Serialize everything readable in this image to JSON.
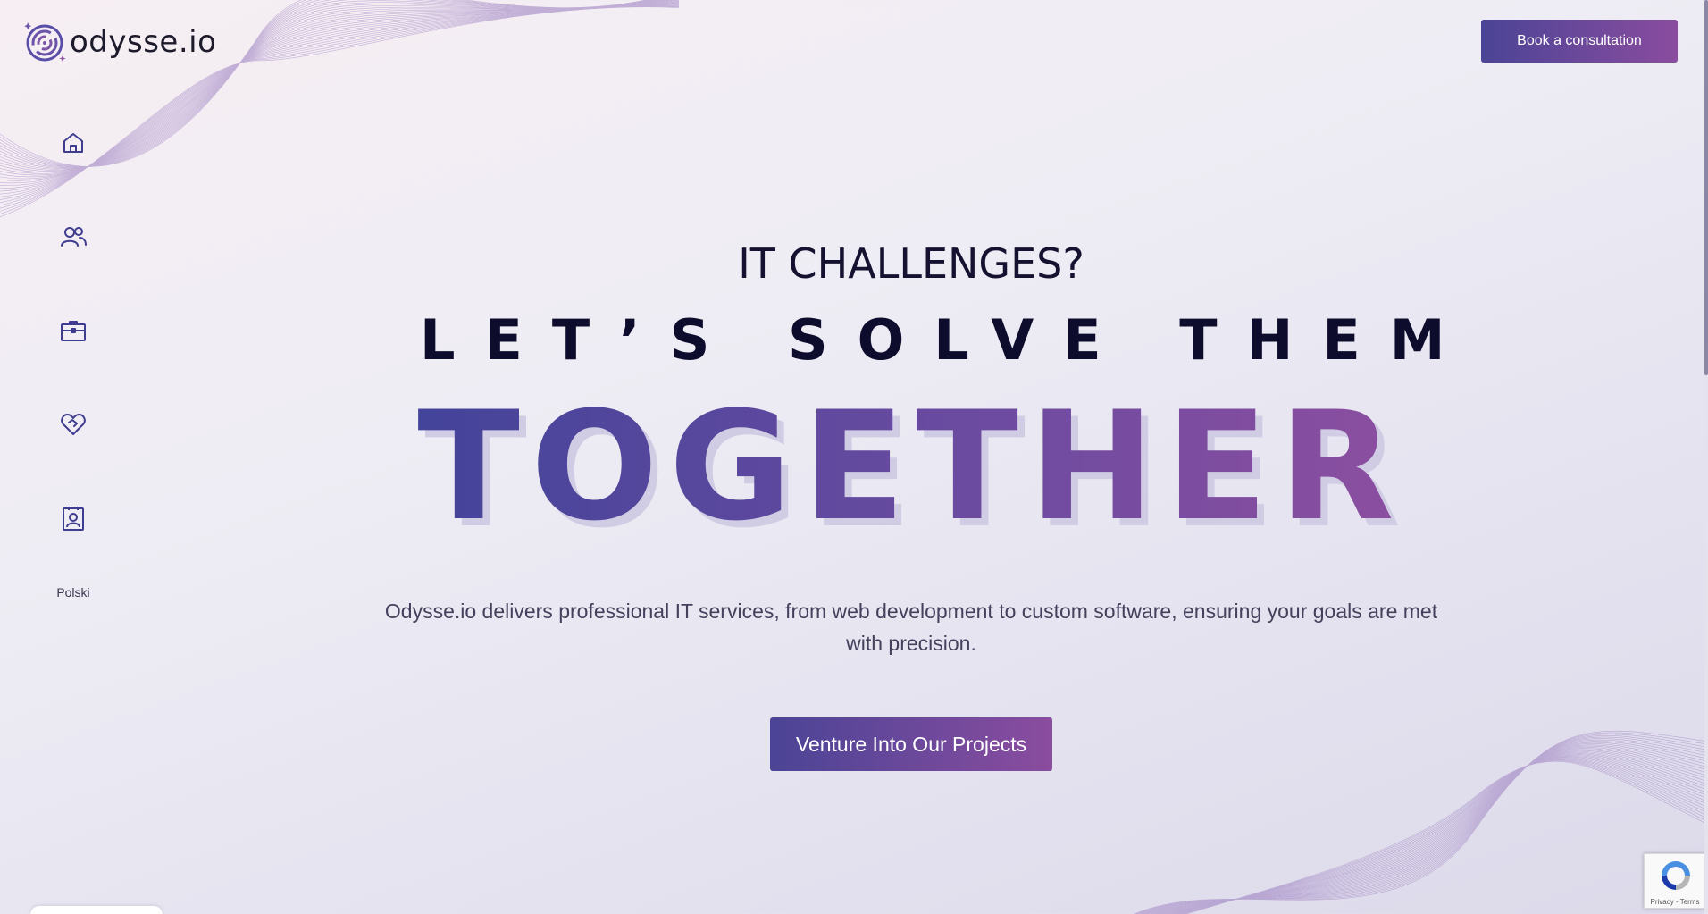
{
  "brand": {
    "name": "odysse.io",
    "logo_icon": "maze-circle-logo-icon",
    "accent_start": "#4b4496",
    "accent_end": "#8a4c9f"
  },
  "header": {
    "cta_label": "Book a consultation"
  },
  "sidebar": {
    "items": [
      {
        "icon": "home-icon"
      },
      {
        "icon": "users-icon"
      },
      {
        "icon": "briefcase-icon"
      },
      {
        "icon": "heart-handshake-icon"
      },
      {
        "icon": "contact-card-icon"
      }
    ],
    "language_label": "Polski"
  },
  "hero": {
    "eyebrow": "IT CHALLENGES?",
    "line2": "LET’S SOLVE THEM",
    "big_word": "TOGETHER",
    "description": "Odysse.io delivers professional IT services, from web development to custom software, ensuring your goals are met with precision.",
    "cta_label": "Venture Into Our Projects"
  },
  "recaptcha": {
    "links": "Privacy - Terms"
  }
}
